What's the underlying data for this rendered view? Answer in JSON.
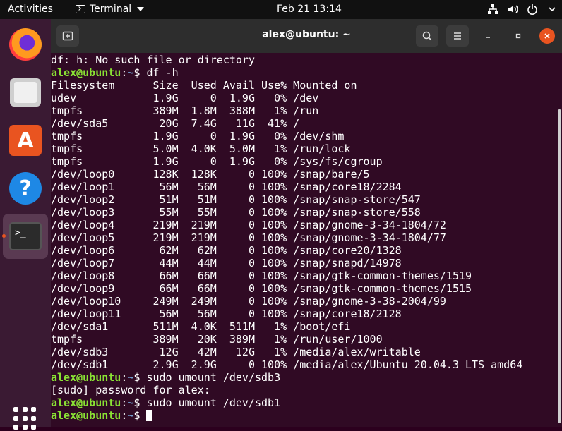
{
  "topbar": {
    "activities": "Activities",
    "app_name": "Terminal",
    "clock": "Feb 21  13:14",
    "icons": [
      "network-icon",
      "volume-icon",
      "power-icon",
      "chevron-down-icon"
    ]
  },
  "dock": {
    "items": [
      "firefox-icon",
      "files-icon",
      "software-store-icon",
      "help-icon",
      "terminal-icon"
    ],
    "active": "terminal-icon",
    "show_apps": "apps-grid-icon",
    "running_indicator_color": "#e95420"
  },
  "window": {
    "title": "alex@ubuntu: ~",
    "buttons": [
      "new-tab-icon",
      "search-icon",
      "menu-icon",
      "minimize-icon",
      "maximize-icon",
      "close-icon"
    ],
    "close_color": "#e95420"
  },
  "terminal": {
    "prompt_user": "alex@ubuntu",
    "prompt_sep": ":",
    "prompt_path": "~",
    "prompt_end": "$ ",
    "colors": {
      "background": "#300a24",
      "user": "#8ae234",
      "path": "#729fcf",
      "text": "#ffffff"
    },
    "lines": [
      {
        "type": "out",
        "text": "df: h: No such file or directory"
      },
      {
        "type": "cmd",
        "text": "df -h"
      },
      {
        "type": "out",
        "text": "Filesystem      Size  Used Avail Use% Mounted on"
      },
      {
        "type": "out",
        "text": "udev            1.9G     0  1.9G   0% /dev"
      },
      {
        "type": "out",
        "text": "tmpfs           389M  1.8M  388M   1% /run"
      },
      {
        "type": "out",
        "text": "/dev/sda5        20G  7.4G   11G  41% /"
      },
      {
        "type": "out",
        "text": "tmpfs           1.9G     0  1.9G   0% /dev/shm"
      },
      {
        "type": "out",
        "text": "tmpfs           5.0M  4.0K  5.0M   1% /run/lock"
      },
      {
        "type": "out",
        "text": "tmpfs           1.9G     0  1.9G   0% /sys/fs/cgroup"
      },
      {
        "type": "out",
        "text": "/dev/loop0      128K  128K     0 100% /snap/bare/5"
      },
      {
        "type": "out",
        "text": "/dev/loop1       56M   56M     0 100% /snap/core18/2284"
      },
      {
        "type": "out",
        "text": "/dev/loop2       51M   51M     0 100% /snap/snap-store/547"
      },
      {
        "type": "out",
        "text": "/dev/loop3       55M   55M     0 100% /snap/snap-store/558"
      },
      {
        "type": "out",
        "text": "/dev/loop4      219M  219M     0 100% /snap/gnome-3-34-1804/72"
      },
      {
        "type": "out",
        "text": "/dev/loop5      219M  219M     0 100% /snap/gnome-3-34-1804/77"
      },
      {
        "type": "out",
        "text": "/dev/loop6       62M   62M     0 100% /snap/core20/1328"
      },
      {
        "type": "out",
        "text": "/dev/loop7       44M   44M     0 100% /snap/snapd/14978"
      },
      {
        "type": "out",
        "text": "/dev/loop8       66M   66M     0 100% /snap/gtk-common-themes/1519"
      },
      {
        "type": "out",
        "text": "/dev/loop9       66M   66M     0 100% /snap/gtk-common-themes/1515"
      },
      {
        "type": "out",
        "text": "/dev/loop10     249M  249M     0 100% /snap/gnome-3-38-2004/99"
      },
      {
        "type": "out",
        "text": "/dev/loop11      56M   56M     0 100% /snap/core18/2128"
      },
      {
        "type": "out",
        "text": "/dev/sda1       511M  4.0K  511M   1% /boot/efi"
      },
      {
        "type": "out",
        "text": "tmpfs           389M   20K  389M   1% /run/user/1000"
      },
      {
        "type": "out",
        "text": "/dev/sdb3        12G   42M   12G   1% /media/alex/writable"
      },
      {
        "type": "out",
        "text": "/dev/sdb1       2.9G  2.9G     0 100% /media/alex/Ubuntu 20.04.3 LTS amd64"
      },
      {
        "type": "cmd",
        "text": "sudo umount /dev/sdb3"
      },
      {
        "type": "out",
        "text": "[sudo] password for alex:"
      },
      {
        "type": "cmd",
        "text": "sudo umount /dev/sdb1"
      },
      {
        "type": "cmd",
        "text": "",
        "cursor": true
      }
    ]
  }
}
